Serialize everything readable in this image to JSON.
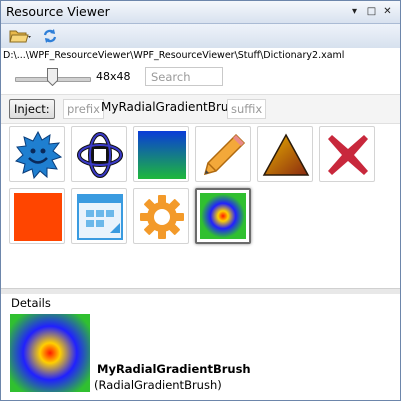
{
  "window": {
    "title": "Resource Viewer",
    "controls": {
      "dropdown": "▾",
      "restore": "□",
      "close": "✕"
    }
  },
  "toolbar": {
    "open_icon": "folder-open-icon",
    "refresh_icon": "refresh-icon"
  },
  "path": "D:\\...\\WPF_ResourceViewer\\WPF_ResourceViewer\\Stuff\\Dictionary2.xaml",
  "size": {
    "label": "48x48"
  },
  "search": {
    "placeholder": "Search"
  },
  "inject": {
    "button_label": "Inject:",
    "prefix": "prefix",
    "name": "MyRadialGradientBrush",
    "suffix": "suffix"
  },
  "resources": [
    {
      "name": "smiley-gear-icon",
      "selected": false
    },
    {
      "name": "atom-icon",
      "selected": false
    },
    {
      "name": "linear-gradient-swatch",
      "selected": false
    },
    {
      "name": "pencil-icon",
      "selected": false
    },
    {
      "name": "triangle-icon",
      "selected": false
    },
    {
      "name": "x-mark-icon",
      "selected": false
    },
    {
      "name": "orange-square-swatch",
      "selected": false
    },
    {
      "name": "window-icon",
      "selected": false
    },
    {
      "name": "gear-icon",
      "selected": false
    },
    {
      "name": "radial-gradient-swatch",
      "selected": true
    }
  ],
  "details": {
    "label": "Details",
    "name": "MyRadialGradientBrush",
    "type": "(RadialGradientBrush)"
  },
  "colors": {
    "title_bar": "#d8e2ef",
    "border": "#6d86ab",
    "orange": "#ff4500",
    "red_x": "#c8283c"
  }
}
